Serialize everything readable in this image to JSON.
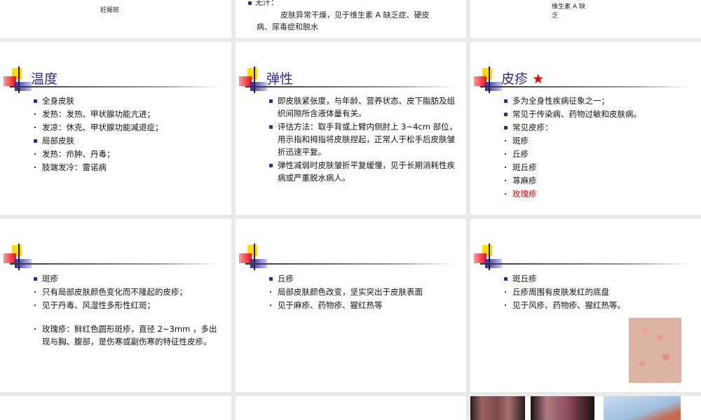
{
  "top_row": {
    "slide1_caption": "妊娠斑",
    "slide2_bullet": "无汗：",
    "slide2_line1": "皮肤异常干燥，见于维生素 A 缺乏症、硬皮",
    "slide2_line2": "病、尿毒症和脱水",
    "slide3_caption_line1": "维生素 A 缺",
    "slide3_caption_line2": "乏"
  },
  "slides": [
    {
      "title": "温度",
      "items": [
        {
          "text": "全身皮肤",
          "level": 1
        },
        {
          "text": "发热：发热、甲状腺功能亢进；",
          "level": 2
        },
        {
          "text": "发凉：休克、甲状腺功能减退症；",
          "level": 2
        },
        {
          "text": "局部皮肤",
          "level": 1
        },
        {
          "text": "发热：疖肿、丹毒；",
          "level": 2
        },
        {
          "text": "肢端发冷：雷诺病",
          "level": 2
        }
      ]
    },
    {
      "title": "弹性",
      "items": [
        {
          "text": "即皮肤紧张度，与年龄、营养状态、皮下脂肪及组织间隙所含液体量有关。",
          "level": 1
        },
        {
          "text": "评估方法：取手背或上臂内侧肘上 3~4cm 部位，用示指和拇指将皮肤捏起，正常人于松手后皮肤皱折迅速平复。",
          "level": 1
        },
        {
          "text": "弹性减弱时皮肤皱折平复缓慢，见于长期消耗性疾病或严重脱水病人。",
          "level": 1
        }
      ]
    },
    {
      "title": "皮疹",
      "title_mark": "★",
      "items": [
        {
          "text": "多为全身性疾病征象之一；",
          "level": 1
        },
        {
          "text": "常见于传染病、药物过敏和皮肤病。",
          "level": 1
        },
        {
          "text": "常见皮疹：",
          "level": 1
        },
        {
          "text": "斑疹",
          "level": 2
        },
        {
          "text": "丘疹",
          "level": 2
        },
        {
          "text": "斑丘疹",
          "level": 2
        },
        {
          "text": "荨麻疹",
          "level": 2
        },
        {
          "text": "玫瑰疹",
          "level": 2,
          "color": "#dd0000"
        }
      ]
    },
    {
      "title": "",
      "items": [
        {
          "text": "斑疹",
          "level": 1
        },
        {
          "text": "只有局部皮肤颜色变化而不隆起的皮疹；",
          "level": 2
        },
        {
          "text": "见于丹毒、风湿性多形性红斑；",
          "level": 2
        },
        {
          "text": "玫瑰疹：鲜红色圆形斑疹，直径 2~3mm ，多出现与胸、腹部，是伤寒或副伤寒的特征性皮疹。",
          "level": 2,
          "gap": true
        }
      ]
    },
    {
      "title": "",
      "items": [
        {
          "text": "丘疹",
          "level": 1
        },
        {
          "text": "局部皮肤颜色改变，坚实突出于皮肤表面",
          "level": 2
        },
        {
          "text": "见于麻疹、药物疹、猩红热等",
          "level": 2
        }
      ]
    },
    {
      "title": "",
      "items": [
        {
          "text": "斑丘疹",
          "level": 1
        },
        {
          "text": "丘疹周围有皮肤发红的底盘",
          "level": 2
        },
        {
          "text": "见于风疹、药物疹、猩红热等。",
          "level": 2
        }
      ]
    }
  ],
  "colors": {
    "title": "#2b2b8c",
    "bullet": "#2b2b9a",
    "highlight": "#dd0000",
    "background": "#e9e9e9"
  }
}
